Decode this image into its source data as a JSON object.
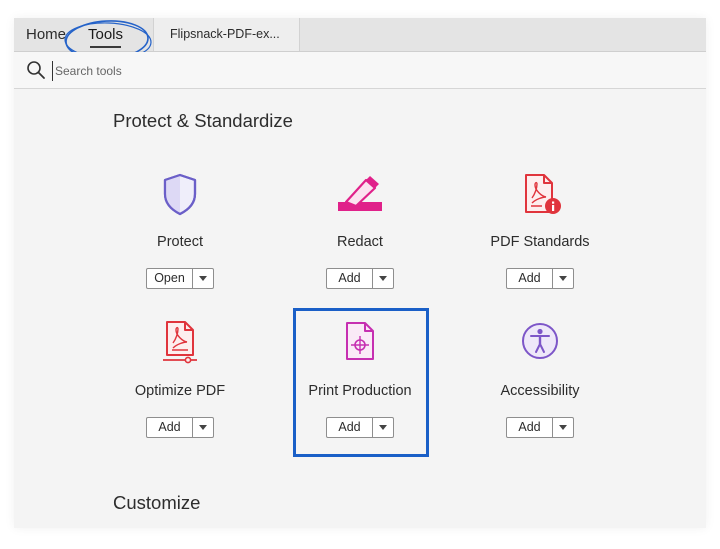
{
  "tabs": {
    "home": "Home",
    "tools": "Tools",
    "document": "Flipsnack-PDF-ex..."
  },
  "search": {
    "placeholder": "Search tools"
  },
  "sections": {
    "protect": "Protect & Standardize",
    "customize": "Customize"
  },
  "tools": {
    "protect": {
      "label": "Protect",
      "button": "Open",
      "icon": "shield-icon"
    },
    "redact": {
      "label": "Redact",
      "button": "Add",
      "icon": "marker-icon"
    },
    "pdf_standards": {
      "label": "PDF Standards",
      "button": "Add",
      "icon": "pdf-info-icon"
    },
    "optimize": {
      "label": "Optimize PDF",
      "button": "Add",
      "icon": "pdf-optimize-icon"
    },
    "print_production": {
      "label": "Print Production",
      "button": "Add",
      "icon": "print-crosshair-icon"
    },
    "accessibility": {
      "label": "Accessibility",
      "button": "Add",
      "icon": "accessibility-person-icon"
    }
  },
  "colors": {
    "accent_blue": "#1a5fc7",
    "annotation_blue": "#2563c9",
    "protect_purple": "#6b5fc8",
    "redact_pink": "#e0218a",
    "pdf_red": "#e0343c",
    "print_magenta": "#c62fb1",
    "access_purple": "#7d56c8"
  }
}
